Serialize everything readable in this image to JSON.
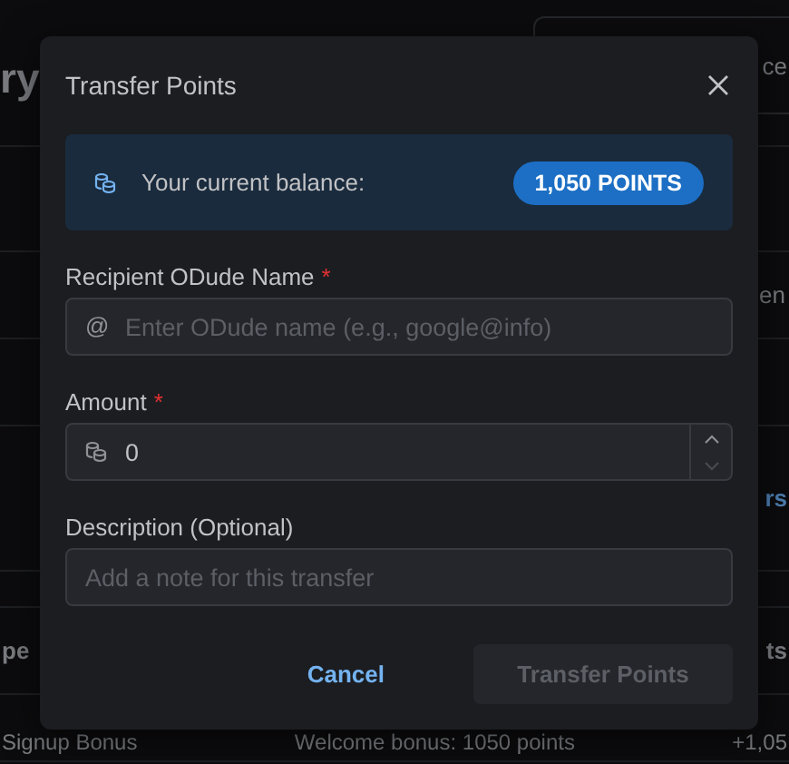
{
  "background": {
    "heading": "ry",
    "box_text": "ce",
    "side_text": "en",
    "link": "rs",
    "table": {
      "columns": [
        "pe",
        "",
        "ts"
      ],
      "rows": [
        {
          "cells": [
            "Signup Bonus",
            "Welcome bonus: 1050 points",
            "+1,05"
          ]
        }
      ]
    }
  },
  "dialog": {
    "title": "Transfer Points",
    "balance": {
      "label": "Your current balance:",
      "value": "1,050 POINTS"
    },
    "fields": [
      {
        "kind": "text",
        "label": "Recipient ODude Name",
        "marker": "*",
        "prefix": "@",
        "placeholder": "Enter ODude name (e.g., google@info)"
      },
      {
        "kind": "number",
        "label": "Amount",
        "marker": "*",
        "value": "0"
      },
      {
        "kind": "text",
        "label": "Description (Optional)",
        "placeholder": "Add a note for this transfer"
      }
    ],
    "buttons": [
      {
        "kind": "link",
        "label": "Cancel",
        "disabled": false
      },
      {
        "kind": "primary",
        "label": "Transfer Points",
        "disabled": true
      }
    ]
  }
}
